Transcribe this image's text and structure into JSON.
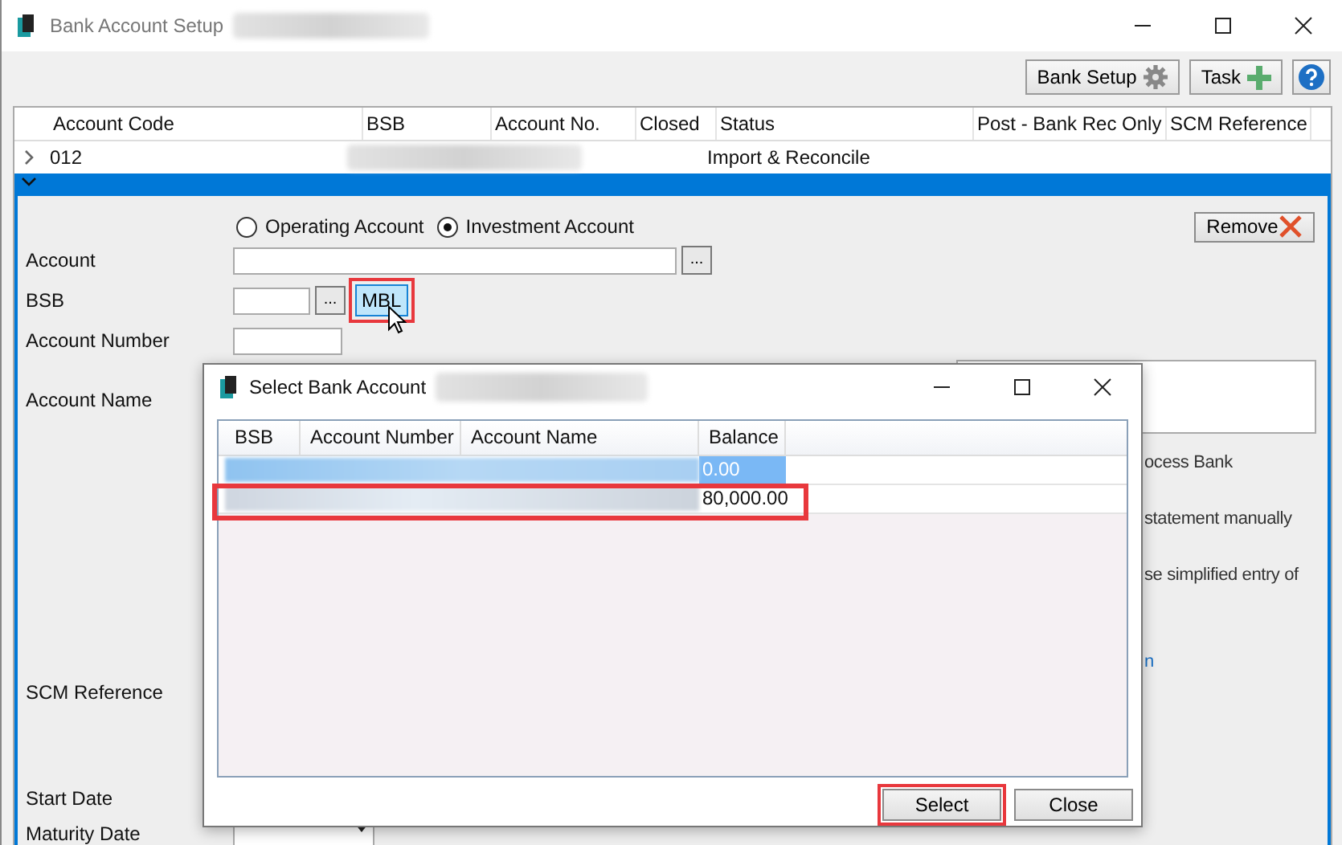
{
  "window": {
    "title": "Bank Account Setup",
    "title_redacted": true
  },
  "toolbar": [
    {
      "label": "Bank Setup",
      "kind": "settings"
    },
    {
      "label": "Task",
      "kind": "add"
    },
    {
      "kind": "help"
    }
  ],
  "grid": {
    "columns": [
      "Account Code",
      "BSB",
      "Account No.",
      "Closed",
      "Status",
      "Post - Bank Rec Only",
      "SCM Reference"
    ],
    "rows": [
      {
        "account_code": "012",
        "status": "Import & Reconcile",
        "redacted": true,
        "expanded": false,
        "selected": false
      },
      {
        "account_code": "",
        "status": "",
        "redacted": false,
        "expanded": true,
        "selected": true
      }
    ]
  },
  "detail": {
    "account_types": [
      {
        "label": "Operating Account",
        "selected": false
      },
      {
        "label": "Investment Account",
        "selected": true
      }
    ],
    "remove_button": "Remove",
    "labels": {
      "account": "Account",
      "bsb": "BSB",
      "account_number": "Account Number",
      "account_name": "Account Name",
      "scm_reference": "SCM Reference",
      "start_date": "Start Date",
      "maturity_date": "Maturity Date"
    },
    "ellipsis": "...",
    "mbl_button": {
      "label": "MBL",
      "highlighted": true,
      "hovered": true
    },
    "description_fragments": [
      "ocess Bank",
      "statement manually",
      "se simplified entry of",
      "n"
    ]
  },
  "dialog": {
    "title": "Select Bank Account",
    "title_redacted": true,
    "columns": [
      "BSB",
      "Account Number",
      "Account Name",
      "Balance"
    ],
    "rows": [
      {
        "balance": "0.00",
        "selected": true,
        "highlighted": false
      },
      {
        "balance": "80,000.00",
        "selected": false,
        "highlighted": true
      }
    ],
    "buttons": [
      {
        "label": "Select",
        "highlighted": true
      },
      {
        "label": "Close",
        "highlighted": false
      }
    ]
  }
}
